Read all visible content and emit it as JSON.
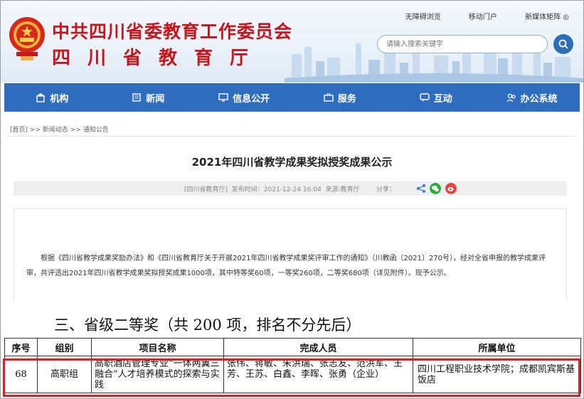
{
  "header": {
    "title_cn1": "中共四川省委教育工作委员会",
    "title_cn2": "四川省教育厅",
    "top_links": [
      "无障碍浏览",
      "移动门户",
      "新媒体矩阵"
    ],
    "search_placeholder": "请输入搜索关键字"
  },
  "nav": {
    "items": [
      {
        "label": "机构",
        "icon": "building-icon"
      },
      {
        "label": "新闻",
        "icon": "news-icon"
      },
      {
        "label": "信息公开",
        "icon": "monitor-icon"
      },
      {
        "label": "服务",
        "icon": "briefcase-icon"
      },
      {
        "label": "互动",
        "icon": "chat-icon"
      },
      {
        "label": "办公系统",
        "icon": "users-icon"
      }
    ]
  },
  "breadcrumb": {
    "home": "[首页]",
    "sep": ">>",
    "level1": "新闻动态",
    "level2": "通知公告"
  },
  "article": {
    "title": "2021年四川省教学成果奖拟授奖成果公示",
    "source_label": "[四川省教育厅]",
    "publish_time": "发布时间：2021-12-24 16:04",
    "origin": "来源:教育厅",
    "share_label": "分享：",
    "paragraph": "根据《四川省教学成果奖励办法》和《四川省教育厅关于开展2021年四川省教学成果奖评审工作的通知》（川教函〔2021〕270号），经对全省申报的教学成果评审，共评选出2021年四川省教学成果奖拟授奖成果1000项，其中特等奖60项，一等奖260项，二等奖680项（详见附件）。现予公示。"
  },
  "document": {
    "heading": "三、省级二等奖（共 200 项，排名不分先后）",
    "columns": [
      "序号",
      "组别",
      "项目名称",
      "完成人员",
      "所属单位"
    ],
    "rows": [
      {
        "no": "68",
        "group": "高职组",
        "project": "高职酒店管理专业“一体两翼三融合”人才培养模式的探索与实践",
        "members": "张伟、蒋敏、朱洪瑞、张志友、范洪军、王芳、王苏、白鑫、李晖、张勇（企业）",
        "unit": "四川工程职业技术学院；成都凯宾斯基饭店"
      }
    ]
  },
  "colors": {
    "brand_red": "#c8161d",
    "nav_blue": "#2e6cc0",
    "highlight": "#e02020"
  }
}
